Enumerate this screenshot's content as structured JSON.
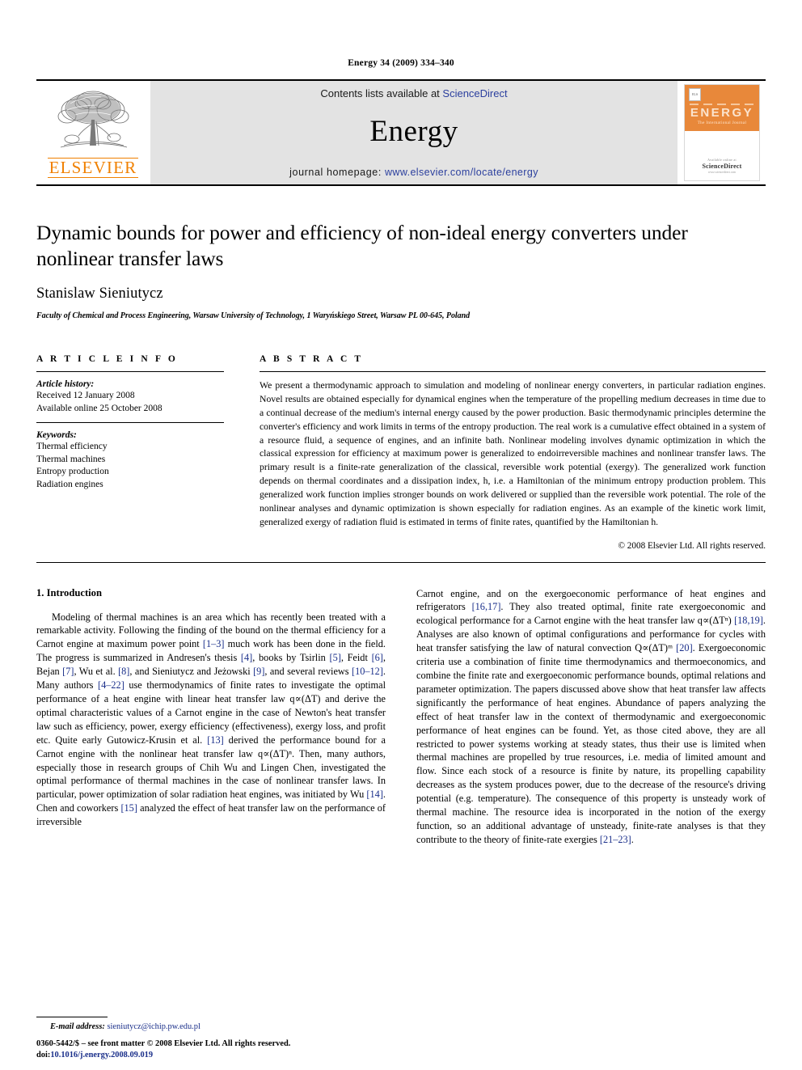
{
  "running_head": "Energy 34 (2009) 334–340",
  "masthead": {
    "publisher_logo_name": "ELSEVIER",
    "contents_prefix": "Contents lists available at ",
    "contents_link": "ScienceDirect",
    "journal_name": "Energy",
    "homepage_prefix": "journal homepage: ",
    "homepage_url": "www.elsevier.com/locate/energy",
    "cover": {
      "badge": "ELS",
      "title": "ENERGY",
      "subtitle": "The International Journal",
      "foot_small": "Available online at",
      "foot_brand": "ScienceDirect",
      "foot_tiny": "www.sciencedirect.com"
    },
    "colors": {
      "elsevier_orange": "#F08000",
      "cover_orange": "#E8883A",
      "link_blue": "#2b3f9e",
      "panel_gray": "#e3e3e3"
    }
  },
  "article": {
    "title": "Dynamic bounds for power and efficiency of non-ideal energy converters under nonlinear transfer laws",
    "authors": "Stanislaw Sieniutycz",
    "affiliation": "Faculty of Chemical and Process Engineering, Warsaw University of Technology, 1 Waryńskiego Street, Warsaw PL 00-645, Poland"
  },
  "article_info": {
    "label": "A R T I C L E   I N F O",
    "history_label": "Article history:",
    "history": [
      "Received 12 January 2008",
      "Available online 25 October 2008"
    ],
    "keywords_label": "Keywords:",
    "keywords": [
      "Thermal efficiency",
      "Thermal machines",
      "Entropy production",
      "Radiation engines"
    ]
  },
  "abstract": {
    "label": "A B S T R A C T",
    "text": "We present a thermodynamic approach to simulation and modeling of nonlinear energy converters, in particular radiation engines. Novel results are obtained especially for dynamical engines when the temperature of the propelling medium decreases in time due to a continual decrease of the medium's internal energy caused by the power production. Basic thermodynamic principles determine the converter's efficiency and work limits in terms of the entropy production. The real work is a cumulative effect obtained in a system of a resource fluid, a sequence of engines, and an infinite bath. Nonlinear modeling involves dynamic optimization in which the classical expression for efficiency at maximum power is generalized to endoirreversible machines and nonlinear transfer laws. The primary result is a finite-rate generalization of the classical, reversible work potential (exergy). The generalized work function depends on thermal coordinates and a dissipation index, h, i.e. a Hamiltonian of the minimum entropy production problem. This generalized work function implies stronger bounds on work delivered or supplied than the reversible work potential. The role of the nonlinear analyses and dynamic optimization is shown especially for radiation engines. As an example of the kinetic work limit, generalized exergy of radiation fluid is estimated in terms of finite rates, quantified by the Hamiltonian h.",
    "copyright": "© 2008 Elsevier Ltd. All rights reserved."
  },
  "introduction": {
    "heading": "1.  Introduction",
    "left_paragraph": "Modeling of thermal machines is an area which has recently been treated with a remarkable activity. Following the finding of the bound on the thermal efficiency for a Carnot engine at maximum power point [1–3] much work has been done in the field. The progress is summarized in Andresen's thesis [4], books by Tsirlin [5], Feidt [6], Bejan [7], Wu et al. [8], and Sieniutycz and Jeżowski [9], and several reviews [10–12]. Many authors [4–22] use thermodynamics of finite rates to investigate the optimal performance of a heat engine with linear heat transfer law q∝(ΔT) and derive the optimal characteristic values of a Carnot engine in the case of Newton's heat transfer law such as efficiency, power, exergy efficiency (effectiveness), exergy loss, and profit etc. Quite early Gutowicz-Krusin et al. [13] derived the performance bound for a Carnot engine with the nonlinear heat transfer law q∝(ΔT)ⁿ. Then, many authors, especially those in research groups of Chih Wu and Lingen Chen, investigated the optimal performance of thermal machines in the case of nonlinear transfer laws. In particular, power optimization of solar radiation heat engines, was initiated by Wu [14]. Chen and coworkers [15] analyzed the effect of heat transfer law on the performance of irreversible",
    "right_paragraph": "Carnot engine, and on the exergoeconomic performance of heat engines and refrigerators [16,17]. They also treated optimal, finite rate exergoeconomic and ecological performance for a Carnot engine with the heat transfer law q∝(ΔTⁿ) [18,19]. Analyses are also known of optimal configurations and performance for cycles with heat transfer satisfying the law of natural convection Q∝(ΔT)ᵐ [20]. Exergoeconomic criteria use a combination of finite time thermodynamics and thermoeconomics, and combine the finite rate and exergoeconomic performance bounds, optimal relations and parameter optimization. The papers discussed above show that heat transfer law affects significantly the performance of heat engines. Abundance of papers analyzing the effect of heat transfer law in the context of thermodynamic and exergoeconomic performance of heat engines can be found. Yet, as those cited above, they are all restricted to power systems working at steady states, thus their use is limited when thermal machines are propelled by true resources, i.e. media of limited amount and flow. Since each stock of a resource is finite by nature, its propelling capability decreases as the system produces power, due to the decrease of the resource's driving potential (e.g. temperature). The consequence of this property is unsteady work of thermal machine. The resource idea is incorporated in the notion of the exergy function, so an additional advantage of unsteady, finite-rate analyses is that they contribute to the theory of finite-rate exergies [21–23]."
  },
  "footer": {
    "email_label": "E-mail address:",
    "email_address": "sieniutycz@ichip.pw.edu.pl",
    "issn_line": "0360-5442/$ – see front matter © 2008 Elsevier Ltd. All rights reserved.",
    "doi_label": "doi:",
    "doi_value": "10.1016/j.energy.2008.09.019"
  }
}
